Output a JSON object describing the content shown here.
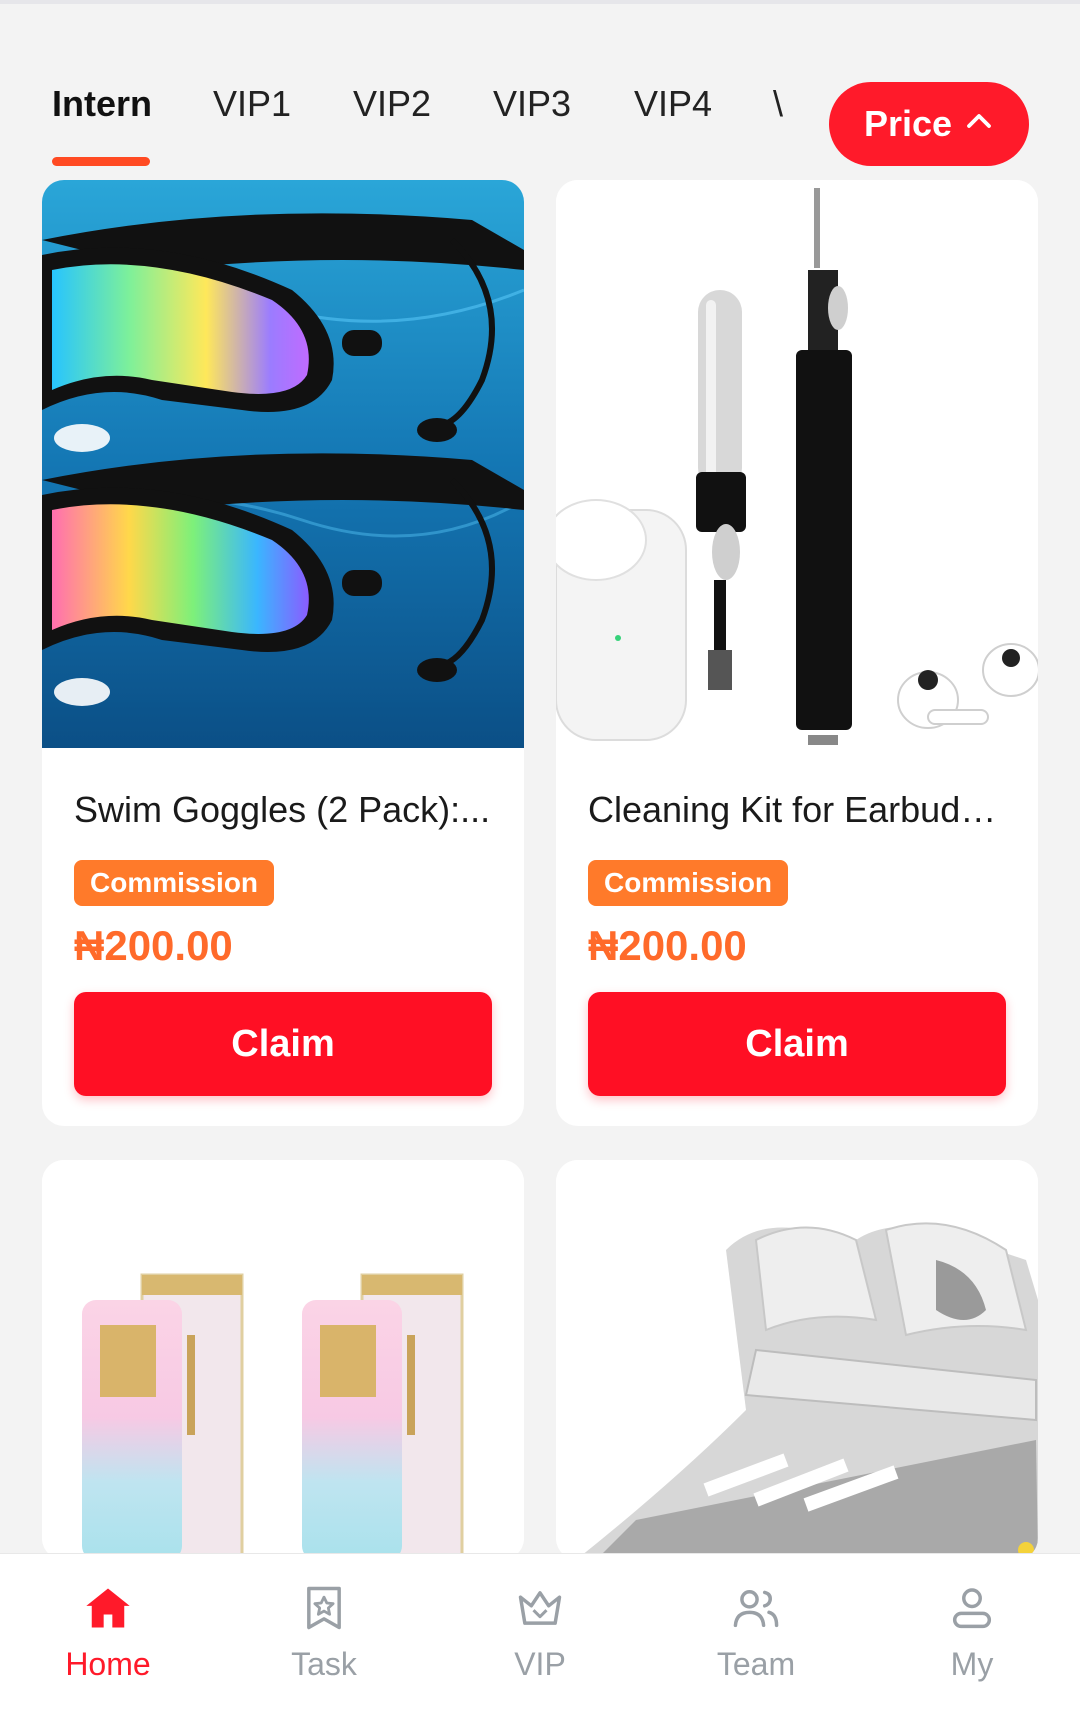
{
  "tabs": [
    "Intern",
    "VIP1",
    "VIP2",
    "VIP3",
    "VIP4",
    "\\"
  ],
  "price_button": "Price",
  "products": [
    {
      "title": "Swim Goggles (2 Pack):...",
      "badge": "Commission",
      "price": "₦200.00",
      "claim": "Claim"
    },
    {
      "title": "Cleaning Kit for Earbuds...",
      "badge": "Commission",
      "price": "₦200.00",
      "claim": "Claim"
    }
  ],
  "nav": [
    "Home",
    "Task",
    "VIP",
    "Team",
    "My"
  ],
  "colors": {
    "accent": "#ff1a2a",
    "commission": "#ff7a2a",
    "price": "#ff6a2a",
    "inactive": "#9aa0a6"
  }
}
